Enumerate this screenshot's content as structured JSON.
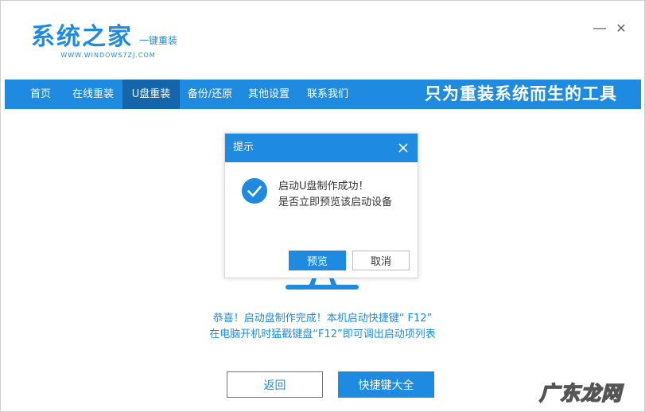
{
  "app": {
    "logo_title": "系统之家",
    "logo_subtitle": "一键重装",
    "logo_url": "WWW.WINDOWS7ZJ.COM",
    "minimize_label": "—",
    "close_label": "✕"
  },
  "nav": {
    "items": [
      {
        "label": "首页"
      },
      {
        "label": "在线重装"
      },
      {
        "label": "U盘重装"
      },
      {
        "label": "备份/还原"
      },
      {
        "label": "其他设置"
      },
      {
        "label": "联系我们"
      }
    ],
    "active_index": 2,
    "slogan": "只为重装系统而生的工具"
  },
  "dialog": {
    "title": "提示",
    "message_line1": "启动U盘制作成功！",
    "message_line2": "是否立即预览该启动设备",
    "preview_label": "预览",
    "cancel_label": "取消",
    "icon": "check-circle-icon"
  },
  "info": {
    "line1": "恭喜！启动盘制作完成！本机启动快捷键“ F12”",
    "line2": "在电脑开机时猛戳键盘“F12”即可调出启动项列表"
  },
  "actions": {
    "back_label": "返回",
    "shortcut_label": "快捷键大全"
  },
  "watermark": {
    "text": "广东龙网"
  },
  "colors": {
    "accent": "#1e8be0",
    "nav_active": "#1565ab"
  }
}
